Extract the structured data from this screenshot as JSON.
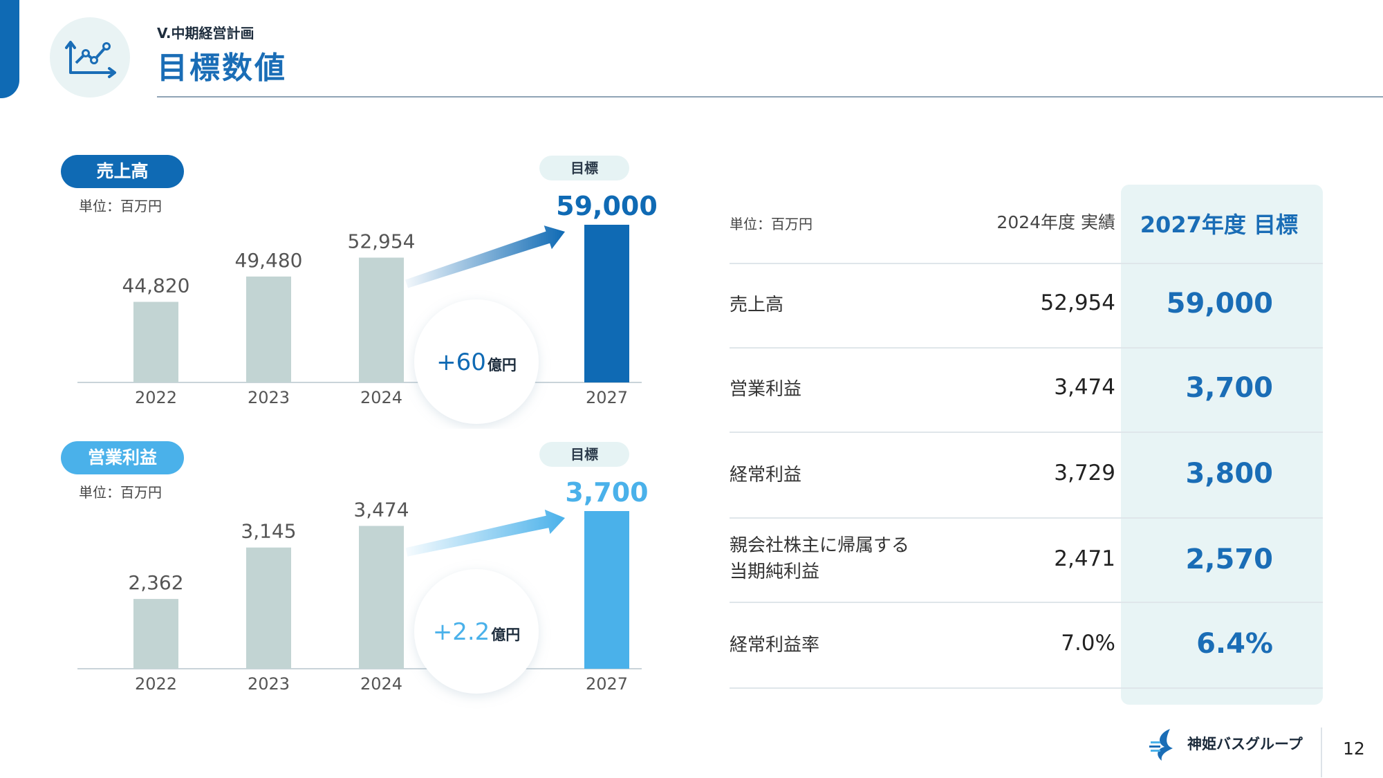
{
  "header": {
    "section_label": "V.中期経営計画",
    "title": "目標数値"
  },
  "charts": {
    "sales": {
      "pill_label": "売上高",
      "unit": "単位：百万円",
      "target_badge": "目標",
      "diff_number": "+60",
      "diff_unit": "億円"
    },
    "operating_income": {
      "pill_label": "営業利益",
      "unit": "単位：百万円",
      "target_badge": "目標",
      "diff_number": "+2.2",
      "diff_unit": "億円"
    }
  },
  "chart_data": [
    {
      "type": "bar",
      "title": "売上高",
      "unit": "単位：百万円",
      "categories": [
        "2022",
        "2023",
        "2024",
        "2027"
      ],
      "values": [
        44820,
        49480,
        52954,
        59000
      ],
      "value_labels": [
        "44,820",
        "49,480",
        "52,954",
        "59,000"
      ],
      "highlight_index": 3,
      "ylim": [
        30000,
        59000
      ],
      "colors": {
        "actual": "#c2d4d3",
        "target": "#0f6ab4"
      }
    },
    {
      "type": "bar",
      "title": "営業利益",
      "unit": "単位：百万円",
      "categories": [
        "2022",
        "2023",
        "2024",
        "2027"
      ],
      "values": [
        2362,
        3145,
        3474,
        3700
      ],
      "value_labels": [
        "2,362",
        "3,145",
        "3,474",
        "3,700"
      ],
      "highlight_index": 3,
      "ylim": [
        1300,
        3700
      ],
      "colors": {
        "actual": "#c2d4d3",
        "target": "#4ab1ea"
      }
    }
  ],
  "table": {
    "unit": "単位：百万円",
    "col_actual": "2024年度 実績",
    "col_target": "2027年度 目標",
    "rows": [
      {
        "label": "売上高",
        "actual": "52,954",
        "target": "59,000"
      },
      {
        "label": "営業利益",
        "actual": "3,474",
        "target": "3,700"
      },
      {
        "label": "経常利益",
        "actual": "3,729",
        "target": "3,800"
      },
      {
        "label_line1": "親会社株主に帰属する",
        "label_line2": "当期純利益",
        "actual": "2,471",
        "target": "2,570"
      },
      {
        "label": "経常利益率",
        "actual": "7.0%",
        "target": "6.4%"
      }
    ]
  },
  "footer": {
    "company": "神姫バスグループ",
    "page_number": "12"
  },
  "colors": {
    "primary_blue": "#0f6ab4",
    "light_blue": "#4ab1ea",
    "bar_gray": "#c2d4d3",
    "target_panel": "#e8f4f5"
  }
}
